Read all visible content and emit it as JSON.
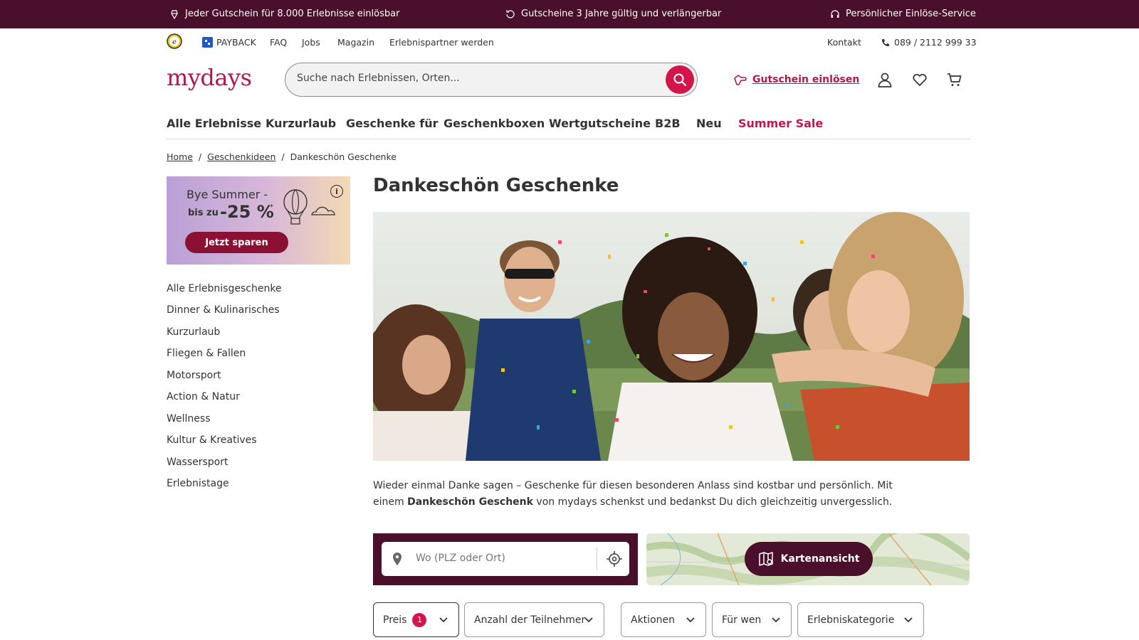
{
  "topbar": {
    "usp1": "Jeder Gutschein für 8.000 Erlebnisse einlösbar",
    "usp2": "Gutscheine 3 Jahre gültig und verlängerbar",
    "usp3": "Persönlicher Einlöse-Service",
    "background": "#4a0f2a"
  },
  "metanav": {
    "payback": "PAYBACK",
    "faq": "FAQ",
    "jobs": "Jobs",
    "magazin": "Magazin",
    "partner": "Erlebnispartner werden",
    "kontakt": "Kontakt",
    "phone": "089 / 2112 999 33"
  },
  "header": {
    "logo": "mydays",
    "search_placeholder": "Suche nach Erlebnissen, Orten...",
    "redeem": "Gutschein einlösen",
    "brand_color": "#b0194a",
    "accent_color": "#d4154b"
  },
  "mainnav": {
    "items": [
      "Alle Erlebnisse",
      "Kurzurlaub",
      "Geschenke für",
      "Geschenkboxen",
      "Wertgutscheine",
      "B2B",
      "Neu",
      "Summer Sale"
    ]
  },
  "breadcrumb": {
    "home": "Home",
    "geschenkideen": "Geschenkideen",
    "current": "Dankeschön Geschenke"
  },
  "promo": {
    "line1": "Bye Summer -",
    "line2": "bis zu",
    "discount": "-25 %",
    "star": "*",
    "button": "Jetzt sparen",
    "info": "i"
  },
  "categories": [
    "Alle Erlebnisgeschenke",
    "Dinner & Kulinarisches",
    "Kurzurlaub",
    "Fliegen & Fallen",
    "Motorsport",
    "Action & Natur",
    "Wellness",
    "Kultur & Kreatives",
    "Wassersport",
    "Erlebnistage"
  ],
  "main": {
    "title": "Dankeschön Geschenke",
    "intro_pre": "Wieder einmal Danke sagen – Geschenke für diesen besonderen Anlass sind kostbar und persönlich. Mit einem ",
    "intro_bold": "Dankeschön Geschenk",
    "intro_post": " von mydays schenkst und bedankst Du dich gleichzeitig unvergesslich."
  },
  "location": {
    "placeholder": "Wo (PLZ oder Ort)"
  },
  "map": {
    "button": "Kartenansicht"
  },
  "filters": {
    "preis": "Preis",
    "preis_count": "1",
    "teilnehmer": "Anzahl der Teilnehmer",
    "aktionen": "Aktionen",
    "fuer_wen": "Für wen",
    "kategorie": "Erlebniskategorie"
  }
}
